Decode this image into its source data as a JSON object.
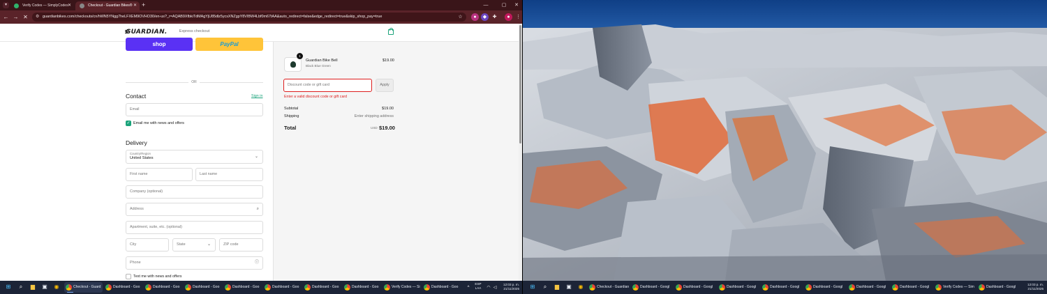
{
  "browser": {
    "tabs": [
      {
        "title": "Verify Codes — SimplyCodes",
        "active": false
      },
      {
        "title": "Checkout - Guardian Bikes®",
        "active": true
      }
    ],
    "new_tab_label": "+",
    "url": "guardianbikes.com/checkouts/cn/hWN5YNgg7heLFXEM9OVHO30/en-us?_r=AQAB9XfbkiTdMAgYjU85dlz5ycsXNZgpY8VIBW4Lbf0m67tAA&auto_redirect=false&edge_redirect=true&skip_shop_pay=true"
  },
  "header": {
    "logo_text": "GUARDIAN."
  },
  "express_checkout": {
    "label": "Express checkout",
    "shop_label": "shop",
    "paypal_label_a": "Pay",
    "paypal_label_b": "Pal",
    "or_label": "OR"
  },
  "contact": {
    "heading": "Contact",
    "signin_label": "Sign in",
    "email_placeholder": "Email",
    "news_label": "Email me with news and offers"
  },
  "delivery": {
    "heading": "Delivery",
    "country_label": "Country/Region",
    "country_value": "United States",
    "first_name": "First name",
    "last_name": "Last name",
    "company": "Company (optional)",
    "address": "Address",
    "apartment": "Apartment, suite, etc. (optional)",
    "city": "City",
    "state": "State",
    "zip": "ZIP code",
    "phone": "Phone",
    "text_label": "Text me with news and offers"
  },
  "order": {
    "quantity": "1",
    "product_name": "Guardian Bike Bell",
    "product_variant": "Black Blue Green",
    "product_price": "$19.00",
    "discount_placeholder": "Discount code or gift card",
    "apply_label": "Apply",
    "error_text": "Enter a valid discount code or gift card",
    "subtotal_label": "Subtotal",
    "subtotal_value": "$19.00",
    "shipping_label": "Shipping",
    "shipping_value": "Enter shipping address",
    "total_label": "Total",
    "total_currency": "USD",
    "total_value": "$19.00"
  },
  "taskbar_left": {
    "items": [
      "Checkout - Guard",
      "Dashboard - Goo",
      "Dashboard - Goo",
      "Dashboard - Goo",
      "Dashboard - Goo",
      "Dashboard - Goo",
      "Dashboard - Goo",
      "Dashboard - Goo",
      "Verify Codes — Si",
      "Dashboard - Goo"
    ],
    "lang_a": "ESP",
    "lang_b": "LAA",
    "time": "12:03 p. m.",
    "date": "21/11/2025"
  },
  "taskbar_right": {
    "items": [
      "Checkout - Guardian",
      "Dashboard - Googl",
      "Dashboard - Googl",
      "Dashboard - Googl",
      "Dashboard - Googl",
      "Dashboard - Googl",
      "Dashboard - Googl",
      "Dashboard - Googl",
      "Verify Codes — Sim",
      "Dashboard - Googl"
    ],
    "time": "12:03 p. m.",
    "date": "21/11/2025"
  },
  "colors": {
    "browser_frame": "#5a2329",
    "shop_purple": "#5a31f4",
    "paypal_yellow": "#ffc439",
    "accent_green": "#1aa37a",
    "error_red": "#dd1d1d",
    "taskbar": "#1c2437"
  }
}
